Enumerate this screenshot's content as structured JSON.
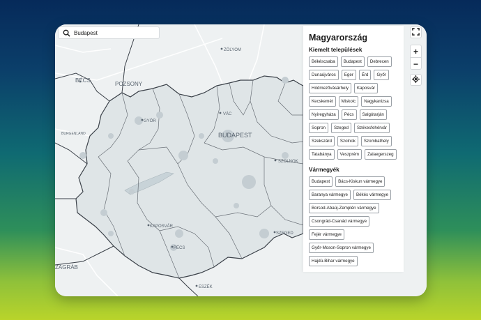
{
  "search": {
    "value": "Budapest"
  },
  "panel": {
    "title": "Magyarország",
    "settlements_heading": "Kiemelt települések",
    "settlements": [
      "Békéscsaba",
      "Budapest",
      "Debrecen",
      "Dunaújváros",
      "Eger",
      "Érd",
      "Győr",
      "Hódmezővásárhely",
      "Kaposvár",
      "Kecskemét",
      "Miskolc",
      "Nagykanizsa",
      "Nyíregyháza",
      "Pécs",
      "Salgótarján",
      "Sopron",
      "Szeged",
      "Székesfehérvár",
      "Szekszárd",
      "Szolnok",
      "Szombathely",
      "Tatabánya",
      "Veszprém",
      "Zalaegerszeg"
    ],
    "counties_heading": "Vármegyék",
    "counties": [
      "Budapest",
      "Bács-Kiskun vármegye",
      "Baranya vármegye",
      "Békés vármegye",
      "Borsod-Abaúj-Zemplén vármegye",
      "Csongrád-Csanád vármegye",
      "Fejér vármegye",
      "Győr-Moson-Sopron vármegye",
      "Hajdú-Bihar vármegye"
    ]
  },
  "map_labels": {
    "becs": "BÉCS",
    "pozsony": "POZSONY",
    "zolyom": "ZÓLYOM",
    "vac": "VÁC",
    "gyor": "GYŐR",
    "budapest": "BUDAPEST",
    "burgenland": "BURGENLAND",
    "szolnok": "SZOLNOK",
    "kaposvar": "KAPOSVÁR",
    "pecs": "PÉCS",
    "szeged": "SZEGED",
    "zagrab": "ZÁGRÁB",
    "eszek": "ESZÉK"
  },
  "controls": {
    "fullscreen_icon": "fullscreen-icon",
    "zoom_in": "+",
    "zoom_out": "−",
    "locate_icon": "locate-icon"
  },
  "colors": {
    "country_fill": "#dfe5e7",
    "outside_fill": "#eef1f2",
    "border": "#3a4048",
    "county_border": "#6b7178",
    "urban": "#c4cdd2"
  }
}
